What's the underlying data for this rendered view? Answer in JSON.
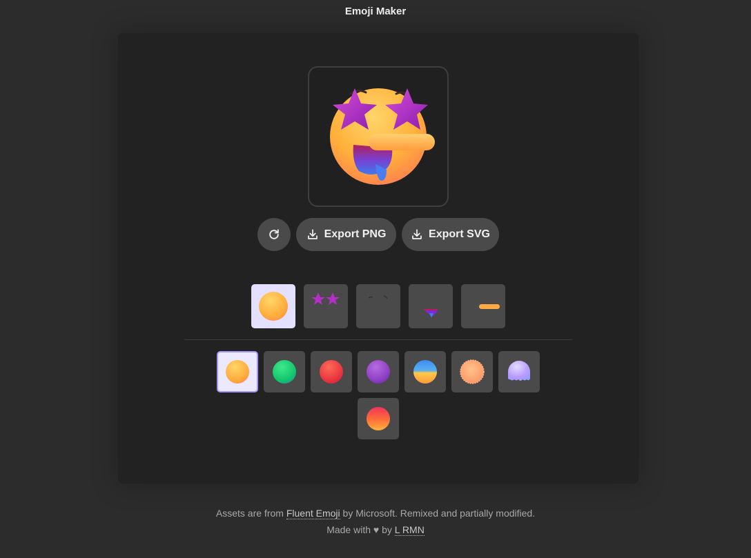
{
  "header": {
    "title": "Emoji Maker"
  },
  "preview": {
    "icon": "star-struck-drooling-emoji"
  },
  "actions": {
    "refresh_icon": "refresh-icon",
    "export_png_label": "Export PNG",
    "export_svg_label": "Export SVG",
    "download_icon": "download-icon"
  },
  "part_tabs": [
    {
      "name": "head",
      "active": true
    },
    {
      "name": "eyes",
      "active": false
    },
    {
      "name": "eyebrows",
      "active": false
    },
    {
      "name": "mouth",
      "active": false
    },
    {
      "name": "details",
      "active": false
    }
  ],
  "head_options": [
    {
      "name": "yellow",
      "active": true
    },
    {
      "name": "green",
      "active": false
    },
    {
      "name": "red",
      "active": false
    },
    {
      "name": "purple",
      "active": false
    },
    {
      "name": "blue-yellow",
      "active": false
    },
    {
      "name": "peach-fuzzy",
      "active": false
    },
    {
      "name": "lavender-melting",
      "active": false
    },
    {
      "name": "red-orange",
      "active": false
    }
  ],
  "footer": {
    "line1_prefix": "Assets are from ",
    "line1_link": "Fluent Emoji",
    "line1_suffix": " by Microsoft. Remixed and partially modified.",
    "line2_prefix": "Made with ♥ by ",
    "line2_link": "L RMN"
  },
  "colors": {
    "accent": "#a596ff",
    "active_tab_bg": "#e4e0ff",
    "button_bg": "#4a4a4a",
    "page_bg": "#2c2c2c",
    "card_bg": "#222222"
  }
}
